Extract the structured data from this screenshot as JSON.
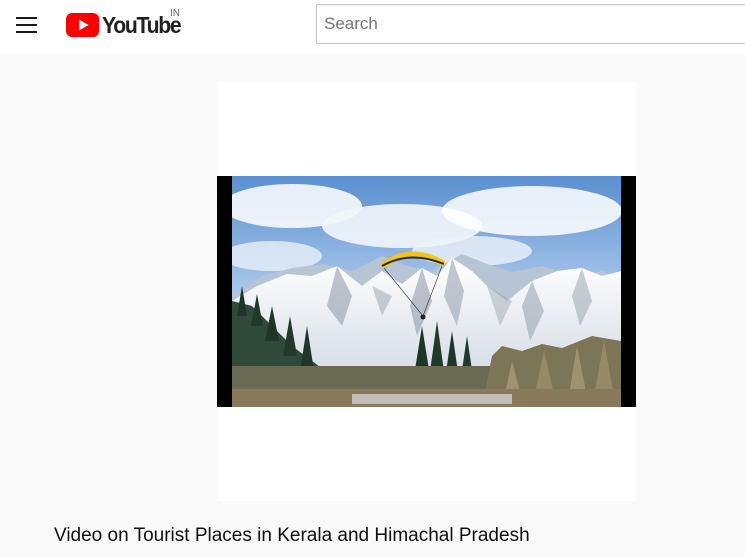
{
  "header": {
    "logo_text": "YouTube",
    "country_code": "IN",
    "brand_color": "#ff0000"
  },
  "search": {
    "placeholder": "Search",
    "value": ""
  },
  "video": {
    "title": "Video on Tourist Places in Kerala and Himachal Pradesh",
    "thumbnail_subject": "snow-capped mountains with paraglider and pine forest"
  },
  "colors": {
    "page_background": "#f9f9f9",
    "header_background": "#ffffff",
    "title_text": "#0f0f0f"
  }
}
